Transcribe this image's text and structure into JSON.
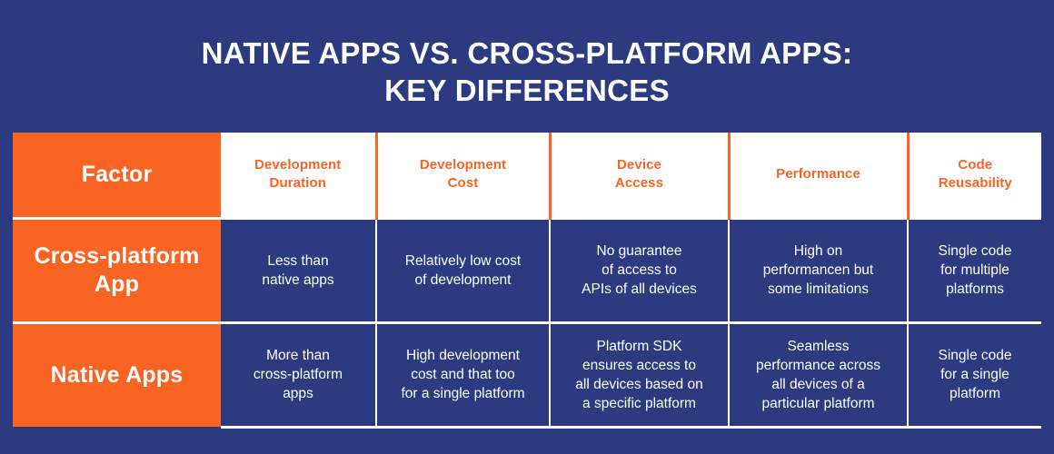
{
  "title": {
    "line1": "NATIVE APPS VS. CROSS-PLATFORM APPS:",
    "line2": "KEY DIFFERENCES"
  },
  "colors": {
    "background": "#2c3a80",
    "accent_orange": "#fa6423",
    "header_bg": "#ffffff",
    "text_light": "#ffffff"
  },
  "table": {
    "headers": [
      "Factor",
      "Development\nDuration",
      "Development\nCost",
      "Device\nAccess",
      "Performance",
      "Code\nReusability"
    ],
    "rows": [
      {
        "label": "Cross-platform\nApp",
        "cells": [
          "Less than\nnative apps",
          "Relatively low cost\nof development",
          "No guarantee\nof access to\nAPIs of all devices",
          "High on\nperformancen but\nsome limitations",
          "Single code\nfor multiple\nplatforms"
        ]
      },
      {
        "label": "Native Apps",
        "cells": [
          "More than\ncross-platform\napps",
          "High development\ncost and that too\nfor a single platform",
          "Platform SDK\nensures access to\nall devices based on\na specific platform",
          "Seamless\nperformance across\nall devices of a\nparticular platform",
          "Single code\nfor a single\nplatform"
        ]
      }
    ]
  }
}
